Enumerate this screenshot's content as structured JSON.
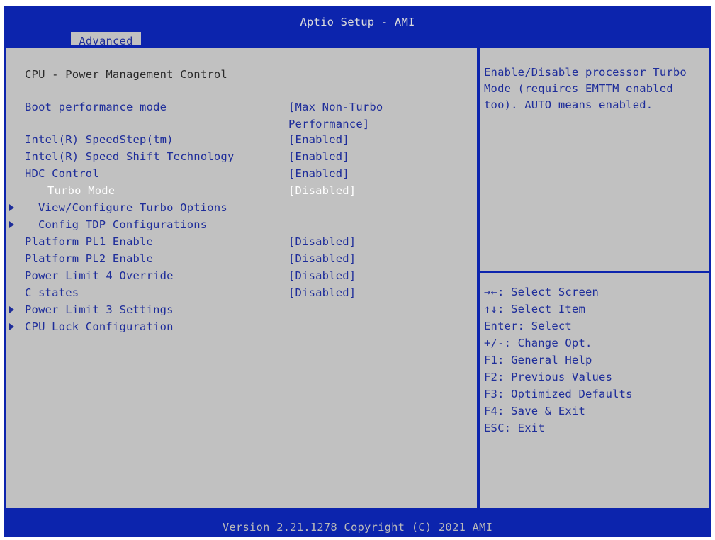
{
  "header": {
    "title": "Aptio Setup - AMI",
    "active_tab": "Advanced"
  },
  "section_title": "CPU - Power Management Control",
  "settings": [
    {
      "label": "Boot performance mode",
      "value": "[Max Non-Turbo",
      "value_cont": "Performance]"
    },
    {
      "label": "Intel(R) SpeedStep(tm)",
      "value": "[Enabled]"
    },
    {
      "label": "Intel(R) Speed Shift Technology",
      "value": "[Enabled]"
    },
    {
      "label": "HDC Control",
      "value": "[Enabled]"
    },
    {
      "label": "Turbo Mode",
      "value": "[Disabled]",
      "selected": true
    },
    {
      "label": "View/Configure Turbo Options",
      "submenu": true
    },
    {
      "label": "Config TDP Configurations",
      "submenu": true
    },
    {
      "label": "Platform PL1 Enable",
      "value": "[Disabled]"
    },
    {
      "label": "Platform PL2 Enable",
      "value": "[Disabled]"
    },
    {
      "label": "Power Limit 4 Override",
      "value": "[Disabled]"
    },
    {
      "label": "C states",
      "value": "[Disabled]"
    },
    {
      "label": "Power Limit 3 Settings",
      "submenu": true
    },
    {
      "label": "CPU Lock Configuration",
      "submenu": true
    }
  ],
  "help": {
    "lines": [
      "Enable/Disable processor Turbo",
      "Mode (requires EMTTM enabled",
      "too). AUTO means enabled."
    ]
  },
  "keys": [
    "→←: Select Screen",
    "↑↓: Select Item",
    "Enter: Select",
    "+/-: Change Opt.",
    "F1: General Help",
    "F2: Previous Values",
    "F3: Optimized Defaults",
    "F4: Save & Exit",
    "ESC: Exit"
  ],
  "footer": {
    "version": "Version 2.21.1278 Copyright (C) 2021 AMI"
  },
  "colors": {
    "frame_blue": "#0c24ad",
    "panel_gray": "#c1c1c1",
    "item_blue": "#1e2d9a",
    "selected_text": "#ffffff"
  }
}
